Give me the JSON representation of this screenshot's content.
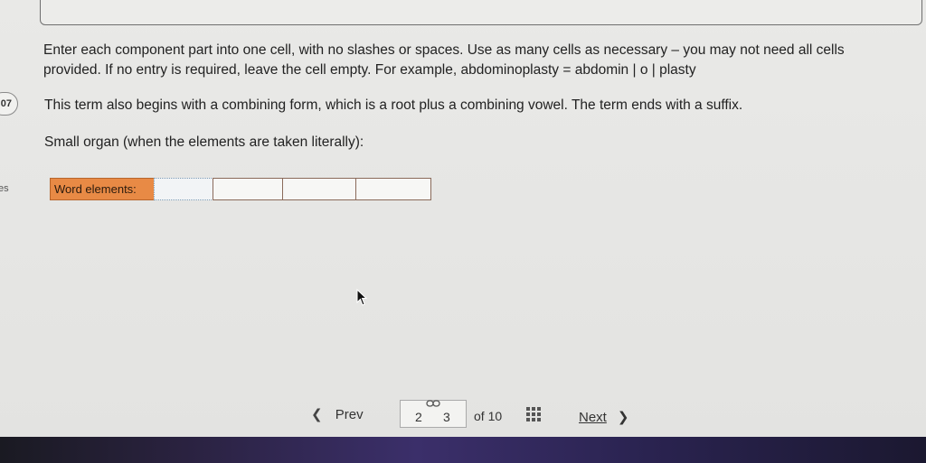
{
  "instructions": {
    "line1": "Enter each component part into one cell, with no slashes or spaces. Use as many cells as necessary – you may not need all cells",
    "line2": "provided. If no entry is required, leave the cell empty. For example, abdominoplasty = abdomin | o | plasty"
  },
  "side": {
    "badge": "07",
    "label": "es"
  },
  "hint": "This term also begins with a combining form, which is a root plus a combining vowel. The term ends with a suffix.",
  "question": "Small organ (when the elements are taken literally):",
  "word_elements": {
    "label": "Word elements:",
    "cells": [
      "",
      "",
      "",
      ""
    ]
  },
  "pagination": {
    "prev_label": "Prev",
    "page_current": "2",
    "page_next": "3",
    "of_label": "of 10",
    "next_label": "Next",
    "prev_icon": "chevron-left-icon",
    "next_icon": "chevron-right-icon",
    "grid_icon": "grid-icon",
    "link_icon": "link-icon"
  },
  "colors": {
    "label_bg": "#e88a45",
    "page_bg": "#e6e6e4"
  }
}
